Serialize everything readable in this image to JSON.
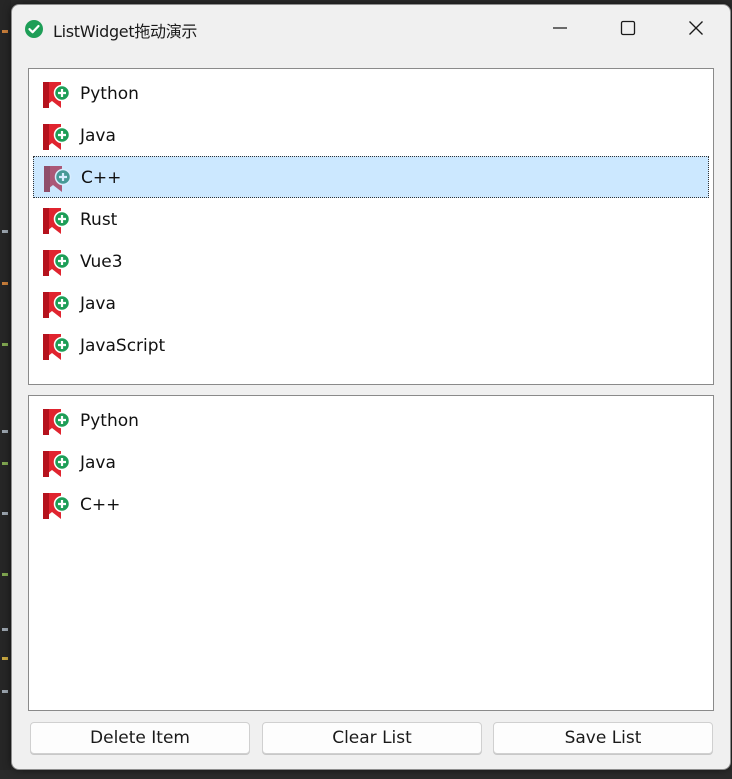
{
  "window": {
    "title": "ListWidget拖动演示",
    "app_icon": "green-check-circle-icon"
  },
  "top_list": {
    "items": [
      {
        "label": "Python",
        "selected": false
      },
      {
        "label": "Java",
        "selected": false
      },
      {
        "label": "C++",
        "selected": true
      },
      {
        "label": "Rust",
        "selected": false
      },
      {
        "label": "Vue3",
        "selected": false
      },
      {
        "label": "Java",
        "selected": false
      },
      {
        "label": "JavaScript",
        "selected": false
      }
    ]
  },
  "bottom_list": {
    "items": [
      {
        "label": "Python"
      },
      {
        "label": "Java"
      },
      {
        "label": "C++"
      }
    ]
  },
  "buttons": {
    "delete_label": "Delete Item",
    "clear_label": "Clear List",
    "save_label": "Save List"
  },
  "colors": {
    "selection": "#cce8ff",
    "icon_red": "#e0242f",
    "icon_green": "#1e9e57"
  }
}
